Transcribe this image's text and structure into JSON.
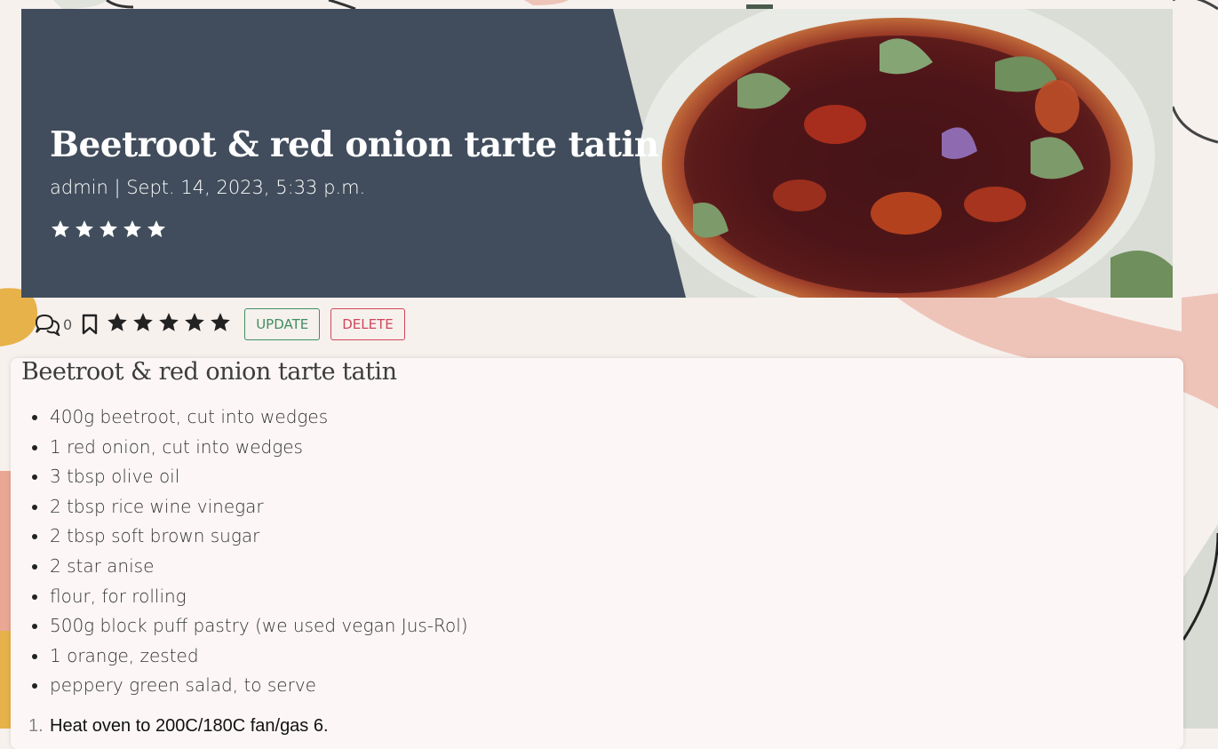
{
  "recipe": {
    "title": "Beetroot & red onion tarte tatin",
    "meta": "admin | Sept. 14, 2023, 5:33 p.m.",
    "hero_rating_stars": 5,
    "comment_count": "0",
    "user_rating_stars": 5,
    "update_label": "UPDATE",
    "delete_label": "DELETE",
    "card_title": "Beetroot & red onion tarte tatin",
    "ingredients": [
      "400g beetroot, cut into wedges",
      "1 red onion, cut into wedges",
      "3 tbsp olive oil",
      "2 tbsp rice wine vinegar",
      "2 tbsp soft brown sugar",
      "2 star anise",
      "flour, for rolling",
      "500g block puff pastry (we used vegan Jus-Rol)",
      "1 orange, zested",
      "peppery green salad, to serve"
    ],
    "method": [
      {
        "number": "1.",
        "text": "Heat oven to 200C/180C fan/gas 6."
      }
    ]
  },
  "icons": {
    "comment": "comments-icon",
    "bookmark": "bookmark-icon",
    "star": "star-icon"
  },
  "colors": {
    "hero_bg": "#414d5c",
    "update": "#3f8f5e",
    "delete": "#d0465a",
    "card_bg": "#fcf7f6",
    "page_bg": "#f7f1ee"
  }
}
